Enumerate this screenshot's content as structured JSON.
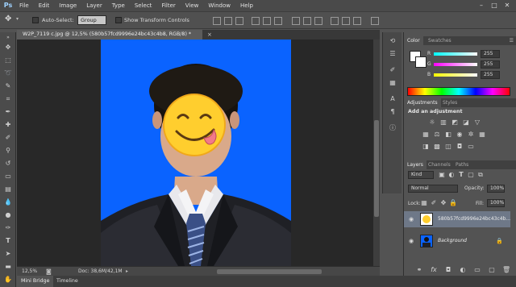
{
  "menu": {
    "logo": "Ps",
    "items": [
      "File",
      "Edit",
      "Image",
      "Layer",
      "Type",
      "Select",
      "Filter",
      "View",
      "Window",
      "Help"
    ]
  },
  "window_controls": [
    "–",
    "□",
    "✕"
  ],
  "options_bar": {
    "auto_select_label": "Auto-Select:",
    "group_value": "Group",
    "transform_label": "Show Transform Controls"
  },
  "document": {
    "tab_title": "W2P_7119 c.jpg @ 12,5% (580b57fcd9996e24bc43c4b8, RGB/8) *",
    "close_glyph": "×",
    "zoom": "12,5%",
    "doc_info": "Doc: 38,6M/42,1M"
  },
  "bottom_tabs": [
    "Mini Bridge",
    "Timeline"
  ],
  "color_panel": {
    "tabs": [
      "Color",
      "Swatches"
    ],
    "r_label": "R",
    "g_label": "G",
    "b_label": "B",
    "r_value": "255",
    "g_value": "255",
    "b_value": "255"
  },
  "adjustments_panel": {
    "tabs": [
      "Adjustments",
      "Styles"
    ],
    "heading": "Add an adjustment"
  },
  "layers_panel": {
    "tabs": [
      "Layers",
      "Channels",
      "Paths"
    ],
    "kind_value": "Kind",
    "blend_mode": "Normal",
    "opacity_label": "Opacity:",
    "opacity_value": "100%",
    "lock_label": "Lock:",
    "fill_label": "Fill:",
    "fill_value": "100%",
    "layers": [
      {
        "name": "580b57fcd9996e24bc43c4b..."
      },
      {
        "name": "Background"
      }
    ]
  },
  "colors": {
    "photo_background": "#0a63ff",
    "panel_bg": "#535353"
  }
}
